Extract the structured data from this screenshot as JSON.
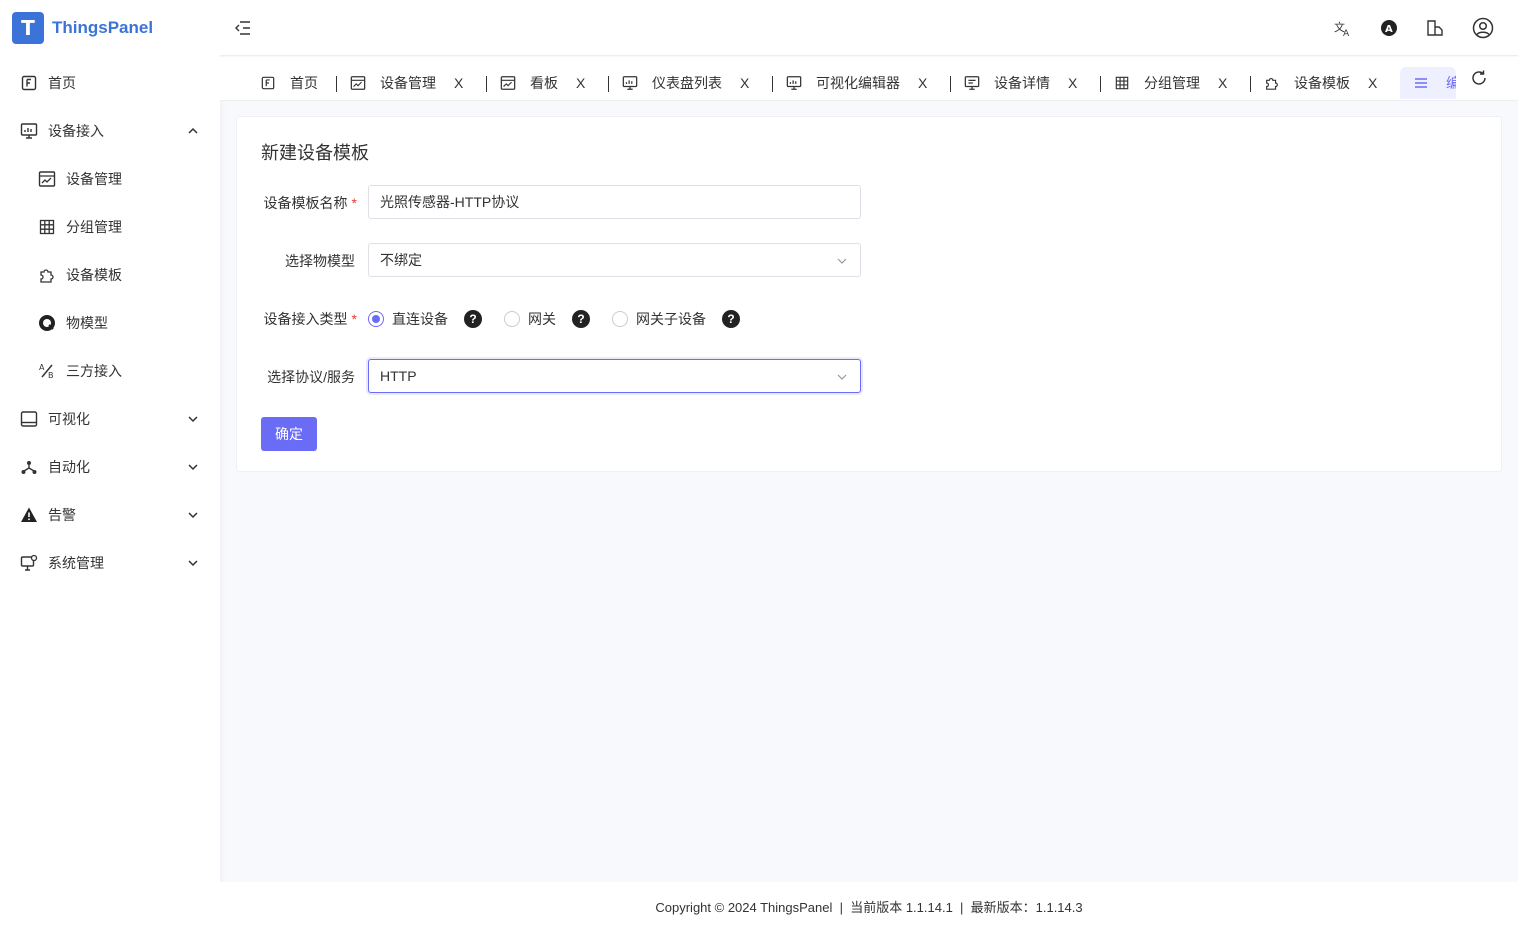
{
  "app": {
    "name": "ThingsPanel",
    "logo_glyph": "T"
  },
  "sidebar": {
    "items": [
      {
        "label": "首页",
        "icon": "home-icon"
      },
      {
        "label": "设备接入",
        "icon": "monitor-icon",
        "expanded": true
      },
      {
        "label": "设备管理",
        "icon": "chart-window-icon"
      },
      {
        "label": "分组管理",
        "icon": "grid-icon"
      },
      {
        "label": "设备模板",
        "icon": "puzzle-icon"
      },
      {
        "label": "物模型",
        "icon": "circle-q-icon"
      },
      {
        "label": "三方接入",
        "icon": "percent-icon"
      },
      {
        "label": "可视化",
        "icon": "tablet-icon"
      },
      {
        "label": "自动化",
        "icon": "network-icon"
      },
      {
        "label": "告警",
        "icon": "warning-icon"
      },
      {
        "label": "系统管理",
        "icon": "monitor-gear-icon"
      }
    ]
  },
  "header": {
    "icons": [
      "translate-icon",
      "theme-a-icon",
      "layout-icon",
      "user-icon"
    ]
  },
  "tabs": {
    "items": [
      {
        "label": "首页"
      },
      {
        "label": "设备管理",
        "close": "X"
      },
      {
        "label": "看板",
        "close": "X"
      },
      {
        "label": "仪表盘列表",
        "close": "X"
      },
      {
        "label": "可视化编辑器",
        "close": "X"
      },
      {
        "label": "设备详情",
        "close": "X"
      },
      {
        "label": "分组管理",
        "close": "X"
      },
      {
        "label": "设备模板",
        "close": "X"
      }
    ],
    "active_partial": "编"
  },
  "form": {
    "title": "新建设备模板",
    "name_label": "设备模板名称",
    "name_value": "光照传感器-HTTP协议",
    "model_label": "选择物模型",
    "model_value": "不绑定",
    "access_label": "设备接入类型",
    "access_options": [
      "直连设备",
      "网关",
      "网关子设备"
    ],
    "access_selected": "直连设备",
    "help_glyph": "?",
    "protocol_label": "选择协议/服务",
    "protocol_value": "HTTP",
    "required_mark": "*",
    "confirm": "确定"
  },
  "footer": {
    "text": "Copyright © 2024 ThingsPanel  |  当前版本 1.1.14.1  |  最新版本：1.1.14.3"
  },
  "colors": {
    "brand": "#3b73d9",
    "accent": "#6b6cf6"
  }
}
